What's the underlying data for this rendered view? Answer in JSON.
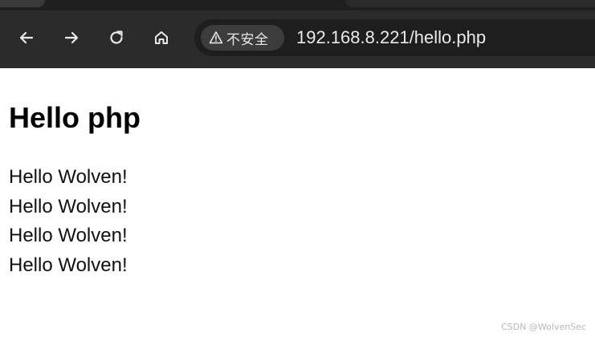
{
  "browser": {
    "address_bar": {
      "security_label": "不安全",
      "url": "192.168.8.221/hello.php"
    },
    "icons": {
      "back": "arrow-left-icon",
      "forward": "arrow-right-icon",
      "reload": "reload-icon",
      "home": "home-icon",
      "security": "warning-triangle-icon"
    }
  },
  "page": {
    "heading": "Hello php",
    "lines": [
      "Hello Wolven!",
      "Hello Wolven!",
      "Hello Wolven!",
      "Hello Wolven!"
    ]
  },
  "watermark": "CSDN @WolvenSec",
  "colors": {
    "toolbar_bg": "#2b2b2b",
    "omnibox_bg": "#1e1e1e",
    "chip_bg": "#3c3c3c",
    "page_bg": "#ffffff",
    "text": "#000000"
  }
}
